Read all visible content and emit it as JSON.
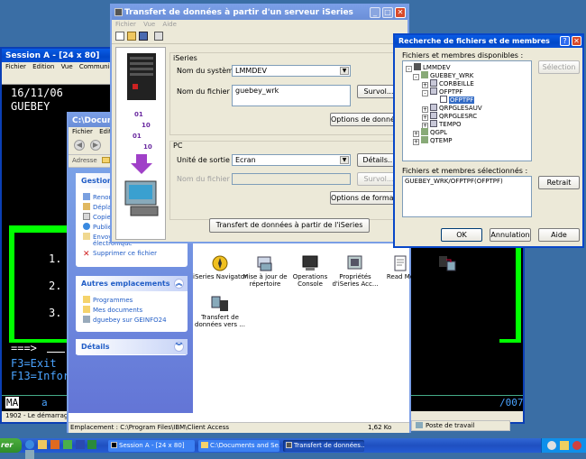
{
  "desktop": {
    "bg": "#3a6ea5"
  },
  "session": {
    "title": "Session A - [24 x 80]",
    "menu": [
      "Fichier",
      "Edition",
      "Vue",
      "Communication"
    ],
    "date": "16/11/06",
    "user": "GUEBEY",
    "options": [
      "1.",
      "2.",
      "3."
    ],
    "arrow": "===>",
    "f3": "F3=Exit",
    "f13": "F13=Infor",
    "status_left": "MA",
    "status_a": "a",
    "status_right": "/007",
    "footer": "1902 - Le démarrag"
  },
  "explorer": {
    "title": "C:\\Docume",
    "menu": [
      "Fichier",
      "Editio"
    ],
    "address_label": "Adresse",
    "task1": {
      "title": "Gestion d",
      "items": [
        "Renom",
        "Déplac",
        "Copier",
        "Publier",
        "Envoy",
        "électronique",
        "Supprimer ce fichier"
      ]
    },
    "task2": {
      "title": "Autres emplacements",
      "items": [
        "Programmes",
        "Mes documents",
        "dguebey sur GEINFO24"
      ]
    },
    "task3": {
      "title": "Détails"
    },
    "icons": [
      {
        "label": "iSeries Navigator",
        "icon": "navigator-icon"
      },
      {
        "label": "Mise à jour de répertoire",
        "icon": "update-directory-icon"
      },
      {
        "label": "Operations Console",
        "icon": "operations-console-icon"
      },
      {
        "label": "Propriétés d'iSeries Acc...",
        "icon": "properties-icon"
      },
      {
        "label": "Read Me",
        "icon": "readme-icon"
      },
      {
        "label": "Transfert de données à pa...",
        "icon": "transfer-from-icon"
      },
      {
        "label": "Transfert de données vers ...",
        "icon": "transfer-to-icon"
      }
    ],
    "status_location": "Emplacement : C:\\Program Files\\IBM\\Client Access",
    "status_size": "1,62 Ko",
    "status_zone": "Poste de travail"
  },
  "transfer": {
    "title": "Transfert de données à partir d'un serveur iSeries",
    "menu": [
      "Fichier",
      "Vue",
      "Aide"
    ],
    "iseries_label": "iSeries",
    "system_label": "Nom du système :",
    "system_value": "LMMDEV",
    "file_label": "Nom du fichier :",
    "file_value": "guebey_wrk",
    "browse1": "Survol...",
    "data_options": "Options de données...",
    "pc_label": "PC",
    "output_label": "Unité de sortie :",
    "output_value": "Ecran",
    "details": "Détails...",
    "pcfile_label": "Nom du fichier :",
    "browse2": "Survol...",
    "format_options": "Options de format...",
    "transfer_button": "Transfert de données à partir de l'iSeries"
  },
  "search": {
    "title": "Recherche de fichiers et de membres",
    "available_label": "Fichiers et membres disponibles :",
    "selection_btn": "Sélection",
    "tree": [
      {
        "label": "LMMDEV",
        "level": 0,
        "pm": "-"
      },
      {
        "label": "GUEBEY_WRK",
        "level": 1,
        "pm": "-"
      },
      {
        "label": "CORBEILLE",
        "level": 2,
        "pm": "+"
      },
      {
        "label": "OFPTPF",
        "level": 2,
        "pm": "-"
      },
      {
        "label": "OFPTPF",
        "level": 3,
        "pm": "",
        "selected": true
      },
      {
        "label": "QRPGLESAUV",
        "level": 2,
        "pm": "+"
      },
      {
        "label": "QRPGLESRC",
        "level": 2,
        "pm": "+"
      },
      {
        "label": "TEMPO",
        "level": 2,
        "pm": "+"
      },
      {
        "label": "QGPL",
        "level": 1,
        "pm": "+"
      },
      {
        "label": "QTEMP",
        "level": 1,
        "pm": "+"
      }
    ],
    "selected_label": "Fichiers et membres sélectionnés :",
    "selected_value": "GUEBEY_WRK/OFPTPF(OFPTPF)",
    "retrait": "Retrait",
    "ok": "OK",
    "cancel": "Annulation",
    "help": "Aide"
  },
  "taskbar": {
    "start": "rer",
    "items": [
      "Session A - [24 x 80]",
      "C:\\Documents and Se...",
      "Transfert de données..."
    ]
  }
}
